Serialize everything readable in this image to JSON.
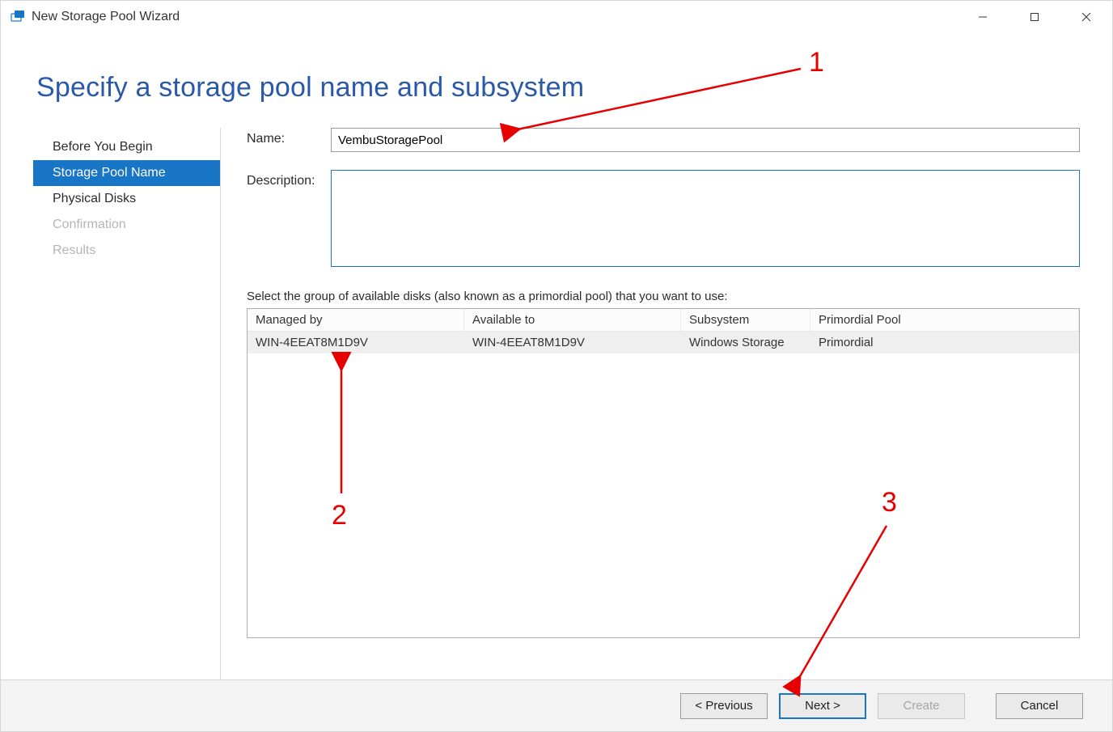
{
  "window": {
    "title": "New Storage Pool Wizard"
  },
  "page": {
    "heading": "Specify a storage pool name and subsystem"
  },
  "sidebar": {
    "items": [
      {
        "label": "Before You Begin",
        "state": "normal"
      },
      {
        "label": "Storage Pool Name",
        "state": "selected"
      },
      {
        "label": "Physical Disks",
        "state": "normal"
      },
      {
        "label": "Confirmation",
        "state": "disabled"
      },
      {
        "label": "Results",
        "state": "disabled"
      }
    ]
  },
  "form": {
    "name_label": "Name:",
    "name_value": "VembuStoragePool",
    "desc_label": "Description:",
    "desc_value": "",
    "instruction": "Select the group of available disks (also known as a primordial pool) that you want to use:"
  },
  "grid": {
    "columns": [
      "Managed by",
      "Available to",
      "Subsystem",
      "Primordial Pool"
    ],
    "rows": [
      {
        "cells": [
          "WIN-4EEAT8M1D9V",
          "WIN-4EEAT8M1D9V",
          "Windows Storage",
          "Primordial"
        ]
      }
    ]
  },
  "footer": {
    "previous": "< Previous",
    "next": "Next >",
    "create": "Create",
    "cancel": "Cancel"
  },
  "annotations": {
    "n1": "1",
    "n2": "2",
    "n3": "3"
  }
}
